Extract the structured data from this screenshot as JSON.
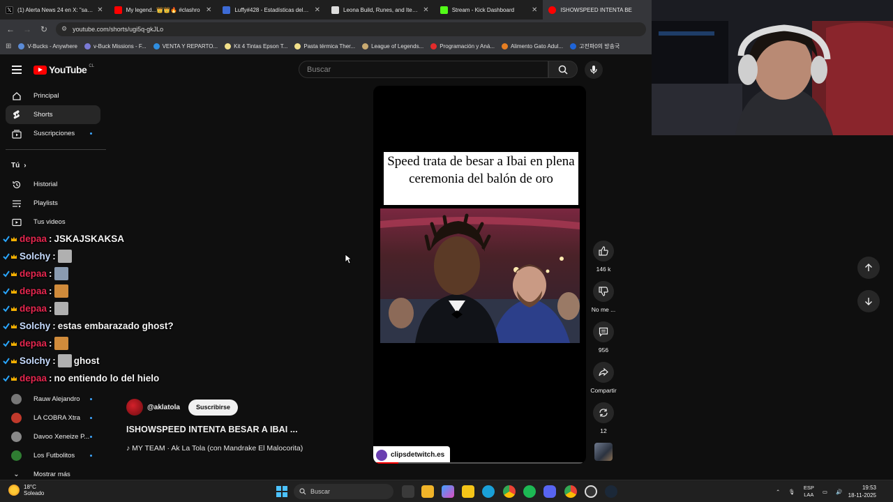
{
  "browser": {
    "tabs": [
      {
        "title": "(1) Alerta News 24 en X: \"saus",
        "color": "#000000"
      },
      {
        "title": "My legend...👑👑🔥 #clashro",
        "color": "#ff0000"
      },
      {
        "title": "Luffy#428 - Estadísticas del inv",
        "color": "#3d6bd6"
      },
      {
        "title": "Leona Build, Runes, and Items",
        "color": "#dddddd"
      },
      {
        "title": "Stream - Kick Dashboard",
        "color": "#53fc18"
      },
      {
        "title": "ISHOWSPEED INTENTA BE",
        "color": "#ff0000"
      }
    ],
    "url": "youtube.com/shorts/ugi5q-gkJLo",
    "bookmarks": [
      {
        "label": "V-Bucks - Anywhere",
        "color": "#5b8bd6"
      },
      {
        "label": "v-Buck Missions - F...",
        "color": "#7a7ad6"
      },
      {
        "label": "VENTA Y REPARTO...",
        "color": "#2f8ee0"
      },
      {
        "label": "Kit 4 Tintas Epson T...",
        "color": "#f2e08a"
      },
      {
        "label": "Pasta térmica Ther...",
        "color": "#f2e08a"
      },
      {
        "label": "League of Legends...",
        "color": "#c9aa71"
      },
      {
        "label": "Programación y Aná...",
        "color": "#e22b2b"
      },
      {
        "label": "Alimento Gato Adul...",
        "color": "#e67e22"
      },
      {
        "label": "고전파0의 방송국",
        "color": "#1e64d8"
      }
    ]
  },
  "youtube": {
    "logo_text": "YouTube",
    "country": "CL",
    "search_placeholder": "Buscar",
    "sidebar": {
      "main": [
        {
          "label": "Principal",
          "icon": "home-icon"
        },
        {
          "label": "Shorts",
          "icon": "shorts-icon"
        },
        {
          "label": "Suscripciones",
          "icon": "subscriptions-icon"
        }
      ],
      "you_heading": "Tú",
      "you": [
        {
          "label": "Historial",
          "icon": "history-icon"
        },
        {
          "label": "Playlists",
          "icon": "playlists-icon"
        },
        {
          "label": "Tus videos",
          "icon": "your-videos-icon"
        }
      ],
      "channels": [
        {
          "label": "Rauw Alejandro",
          "color": "#777777"
        },
        {
          "label": "LA COBRA Xtra",
          "color": "#c0392b"
        },
        {
          "label": "Davoo Xeneize P...",
          "color": "#888888"
        },
        {
          "label": "Los Futbolitos",
          "color": "#2f7d32"
        }
      ],
      "show_more": "Mostrar más"
    },
    "short": {
      "caption": "Speed trata de besar a Ibai en plena ceremonia del balón de oro",
      "watermark": "clipsdetwitch.es",
      "progress": 0.12,
      "channel": "@aklatola",
      "subscribe": "Suscribirse",
      "title": "ISHOWSPEED INTENTA  BESAR A IBAI ...",
      "music": "MY TEAM · Ak La Tola (con Mandrake El Malocorita)"
    },
    "actions": {
      "likes": "146 k",
      "dislike": "No me ...",
      "comments": "956",
      "share": "Compartir",
      "remix": "12"
    }
  },
  "chat": [
    {
      "user": "depaa",
      "user_color": "#e5274f",
      "message": "JSKAJSKAKSA",
      "emote": false
    },
    {
      "user": "Solchy",
      "user_color": "#c7dcff",
      "message": "",
      "emote": true
    },
    {
      "user": "depaa",
      "user_color": "#e5274f",
      "message": "",
      "emote": true
    },
    {
      "user": "depaa",
      "user_color": "#e5274f",
      "message": "",
      "emote": true
    },
    {
      "user": "depaa",
      "user_color": "#e5274f",
      "message": "",
      "emote": true
    },
    {
      "user": "Solchy",
      "user_color": "#c7dcff",
      "message": "estas embarazado ghost?",
      "emote": false
    },
    {
      "user": "depaa",
      "user_color": "#e5274f",
      "message": "",
      "emote": true
    },
    {
      "user": "Solchy",
      "user_color": "#c7dcff",
      "message": "ghost",
      "emote": true
    },
    {
      "user": "depaa",
      "user_color": "#e5274f",
      "message": "no entiendo lo del hielo",
      "emote": false
    }
  ],
  "taskbar": {
    "temperature": "18°C",
    "weather": "Soleado",
    "search": "Buscar",
    "lang": "ESP",
    "layout": "LAA",
    "time": "19:53",
    "date": "18-11-2025"
  }
}
